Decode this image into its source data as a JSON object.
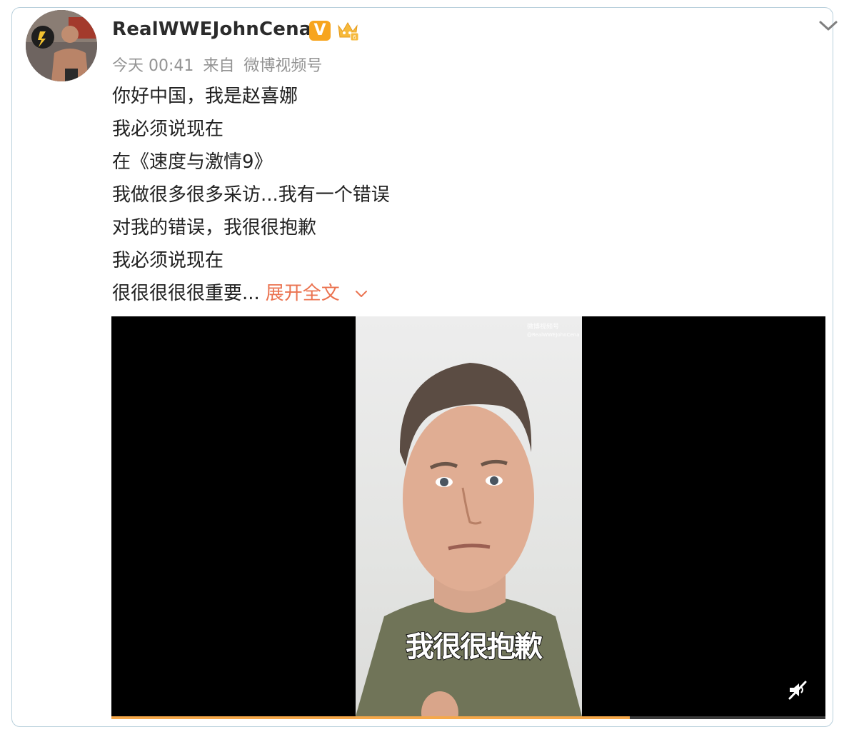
{
  "post": {
    "username": "RealWWEJohnCena",
    "verified_badge": "V",
    "member_icon": "crown-icon",
    "time": "今天 00:41",
    "source_prefix": "来自",
    "source": "微博视频号",
    "lines": [
      "你好中国，我是赵喜娜",
      "我必须说现在",
      "在《速度与激情9》",
      "我做很多很多采访...我有一个错误",
      "对我的错误，我很很抱歉",
      "我必须说现在",
      "很很很很很重要..."
    ],
    "expand_label": "展开全文"
  },
  "video": {
    "watermark_brand": "微博视频号",
    "watermark_handle": "@RealWWEJohnCena",
    "subtitle": "我很很抱歉",
    "progress": 0.726
  },
  "colors": {
    "accent": "#eb7350",
    "badge": "#f7a51f",
    "progress": "#f5a84a",
    "border": "#b9d0dc"
  }
}
